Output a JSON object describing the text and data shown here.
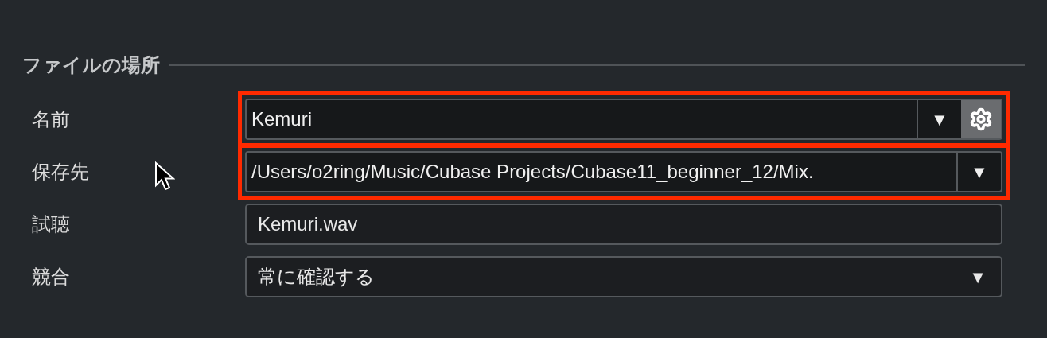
{
  "section": {
    "title": "ファイルの場所"
  },
  "rows": [
    {
      "label": "名前",
      "kind": "combo_gear",
      "value": "Kemuri",
      "arrow": "▼",
      "highlighted": true
    },
    {
      "label": "保存先",
      "kind": "combo",
      "value": "/Users/o2ring/Music/Cubase Projects/Cubase11_beginner_12/Mix.",
      "arrow": "▼",
      "highlighted": true
    },
    {
      "label": "試聴",
      "kind": "text",
      "value": "Kemuri.wav",
      "highlighted": false
    },
    {
      "label": "競合",
      "kind": "select",
      "value": "常に確認する",
      "arrow": "▼",
      "highlighted": false
    }
  ]
}
